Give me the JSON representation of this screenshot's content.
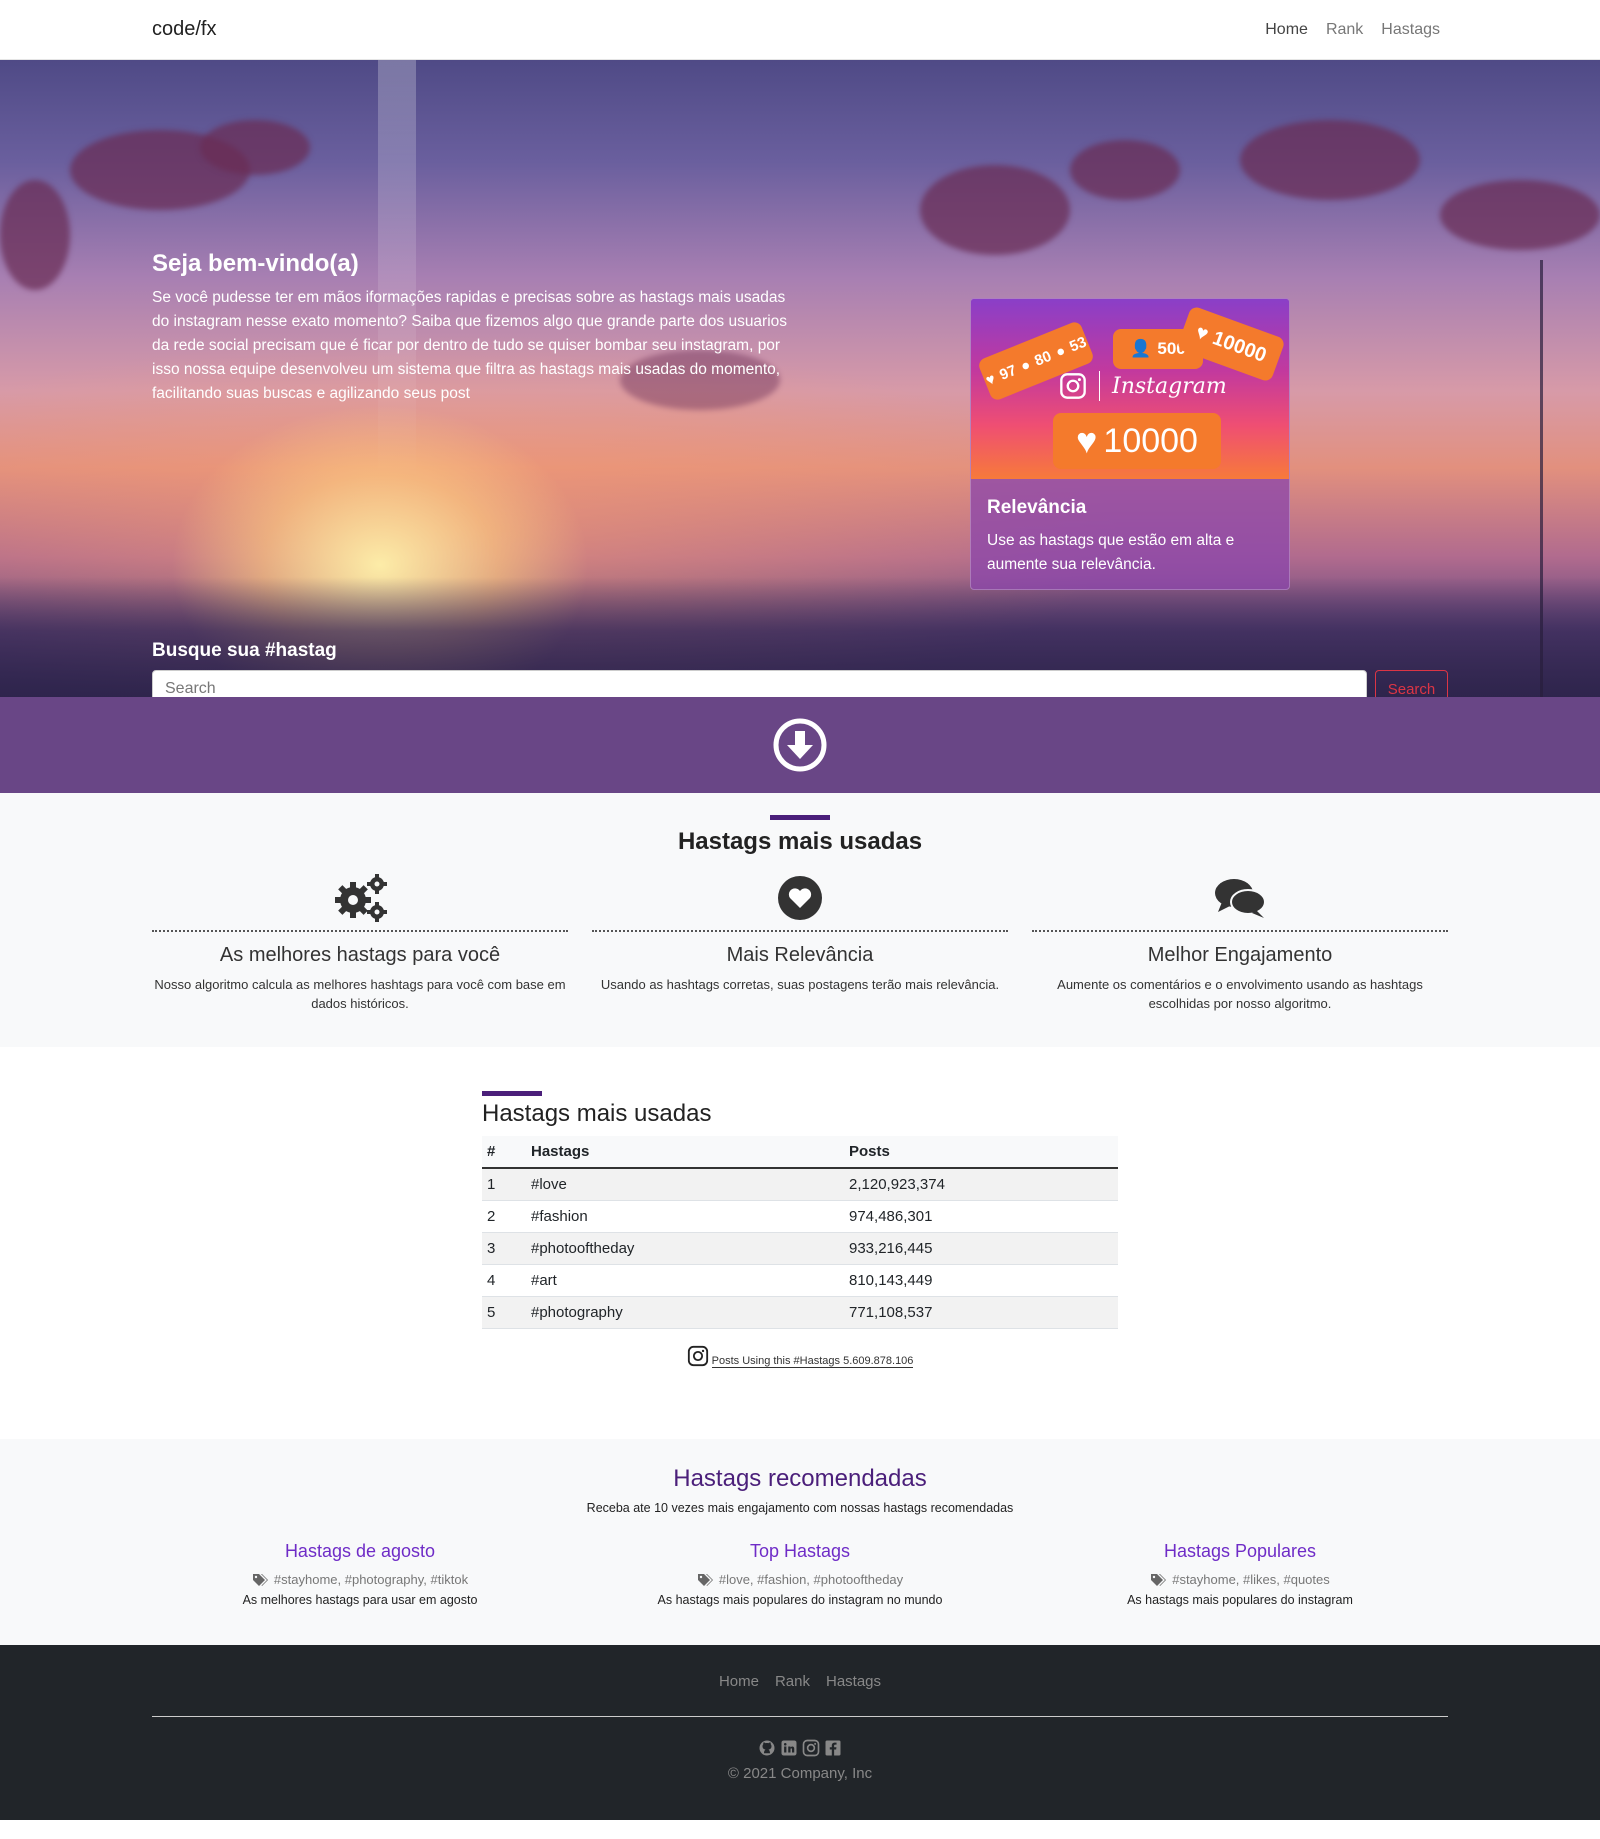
{
  "navbar": {
    "brand": "code/fx",
    "links": [
      "Home",
      "Rank",
      "Hastags"
    ]
  },
  "hero": {
    "title": "Seja bem-vindo(a)",
    "text": "Se você pudesse ter em mãos iformações rapidas e precisas sobre as hastags mais usadas do instagram nesse exato momento? Saiba que fizemos algo que grande parte dos usuarios da rede social precisam que é ficar por dentro de tudo se quiser bombar seu instagram, por isso nossa equipe desenvolveu um sistema que filtra as hastags mais usadas do momento, facilitando suas buscas e agilizando seus post",
    "card": {
      "image_labels": {
        "likes": "97",
        "follows": "80",
        "comments": "53",
        "followers": "500",
        "hearts": "10000",
        "brand": "Instagram",
        "big_likes": "10000"
      },
      "title": "Relevância",
      "text": "Use as hastags que estão em alta e aumente sua relevância."
    },
    "search": {
      "title": "Busque sua #hastag",
      "placeholder": "Search",
      "button": "Search"
    }
  },
  "features": {
    "title": "Hastags mais usadas",
    "items": [
      {
        "icon": "gears-icon",
        "title": "As melhores hastags para você",
        "text": "Nosso algoritmo calcula as melhores hashtags para você com base em dados históricos."
      },
      {
        "icon": "heart-circle-icon",
        "title": "Mais Relevância",
        "text": "Usando as hashtags corretas, suas postagens terão mais relevância."
      },
      {
        "icon": "comments-icon",
        "title": "Melhor Engajamento",
        "text": "Aumente os comentários e o envolvimento usando as hashtags escolhidas por nosso algoritmo."
      }
    ]
  },
  "table": {
    "title": "Hastags mais usadas",
    "headers": [
      "#",
      "Hastags",
      "Posts"
    ],
    "rows": [
      [
        "1",
        "#love",
        "2,120,923,374"
      ],
      [
        "2",
        "#fashion",
        "974,486,301"
      ],
      [
        "3",
        "#photooftheday",
        "933,216,445"
      ],
      [
        "4",
        "#art",
        "810,143,449"
      ],
      [
        "5",
        "#photography",
        "771,108,537"
      ]
    ],
    "posts_note": "Posts Using this #Hastags 5.609.878.106"
  },
  "recommended": {
    "title": "Hastags recomendadas",
    "lead": "Receba ate 10 vezes mais engajamento com nossas hastags recomendadas",
    "items": [
      {
        "title": "Hastags de agosto",
        "tags": "#stayhome, #photography, #tiktok",
        "desc": "As melhores hastags para usar em agosto"
      },
      {
        "title": "Top Hastags",
        "tags": "#love, #fashion, #photooftheday",
        "desc": "As hastags mais populares do instagram no mundo"
      },
      {
        "title": "Hastags Populares",
        "tags": "#stayhome, #likes, #quotes",
        "desc": "As hastags mais populares do instagram"
      }
    ]
  },
  "footer": {
    "links": [
      "Home",
      "Rank",
      "Hastags"
    ],
    "socials": [
      "github-icon",
      "linkedin-icon",
      "instagram-icon",
      "facebook-icon"
    ],
    "copyright": "© 2021 Company, Inc"
  },
  "colors": {
    "accent_purple": "#694686",
    "title_purple": "#4b1f7a",
    "link_purple": "#6f2cc7",
    "danger": "#dc3545",
    "footer_bg": "#212529"
  }
}
